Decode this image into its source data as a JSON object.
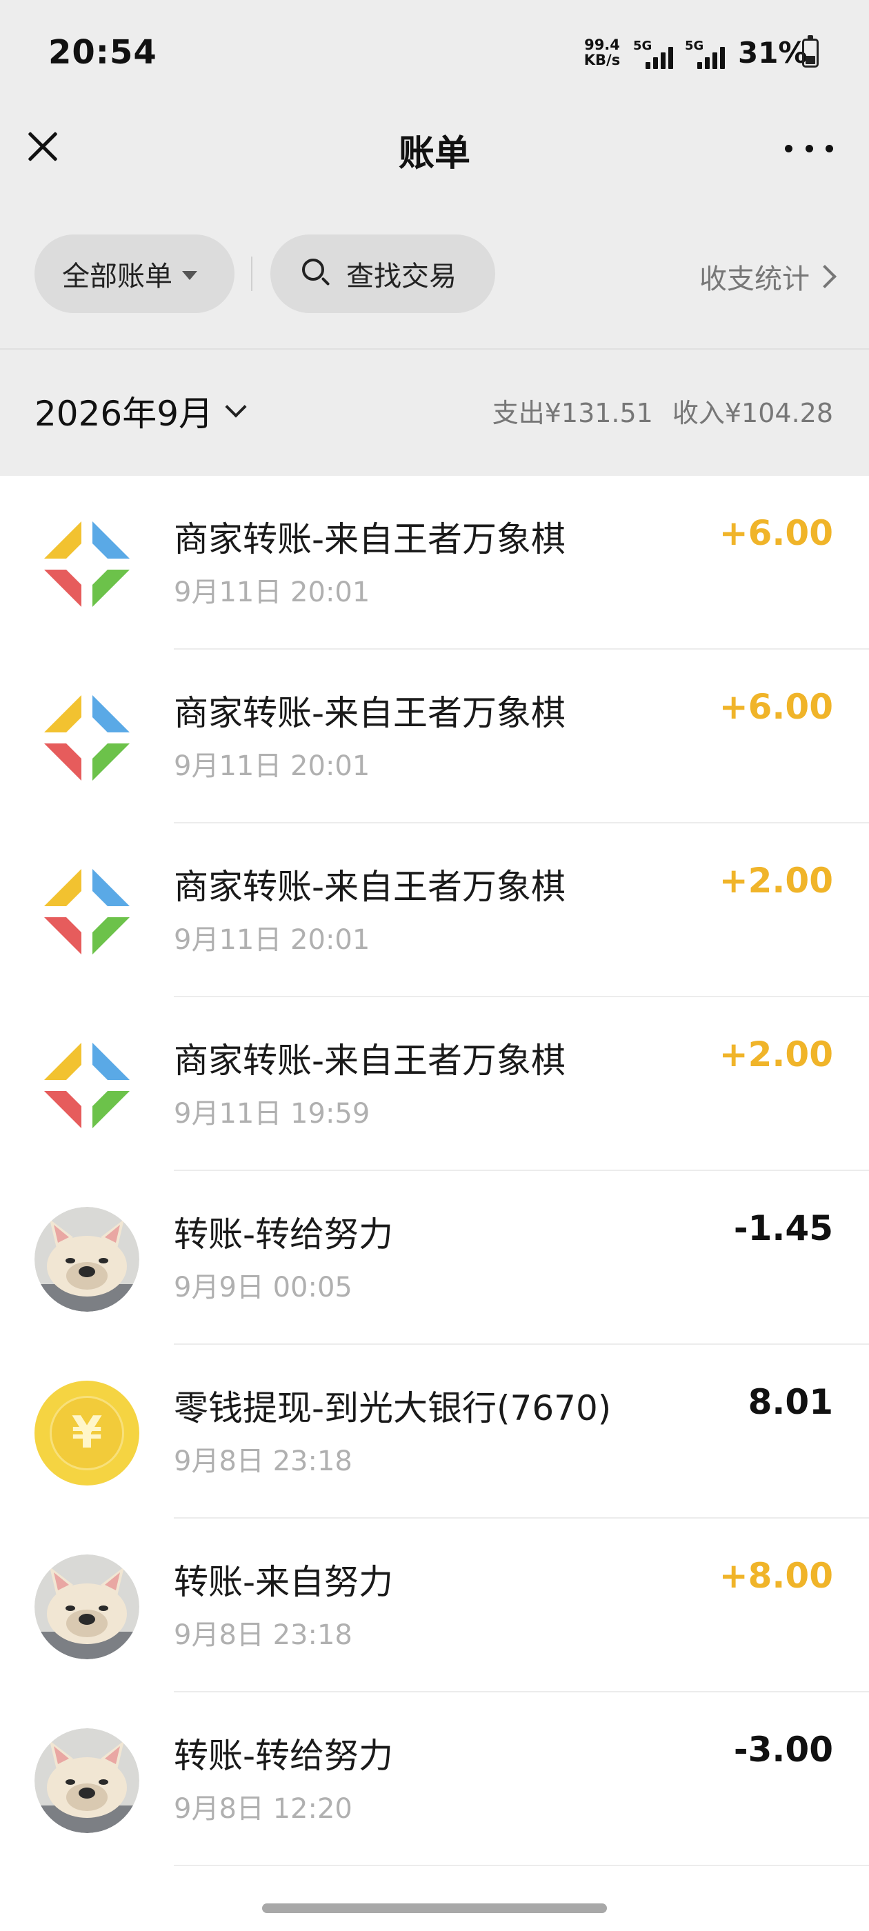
{
  "status_bar": {
    "time": "20:54",
    "net_speed_value": "99.4",
    "net_speed_unit": "KB/s",
    "signal_1_label": "5G",
    "signal_2_label": "5G",
    "battery": "31%"
  },
  "header": {
    "title": "账单"
  },
  "filters": {
    "all_bills": "全部账单",
    "search": "查找交易",
    "stats": "收支统计"
  },
  "month": {
    "label": "2026年9月",
    "expense": "支出¥131.51",
    "income": "收入¥104.28"
  },
  "transactions": [
    {
      "title": "商家转账-来自王者万象棋",
      "time": "9月11日 20:01",
      "amount": "+6.00",
      "kind": "in",
      "icon": "merchant-logo-icon"
    },
    {
      "title": "商家转账-来自王者万象棋",
      "time": "9月11日 20:01",
      "amount": "+6.00",
      "kind": "in",
      "icon": "merchant-logo-icon"
    },
    {
      "title": "商家转账-来自王者万象棋",
      "time": "9月11日 20:01",
      "amount": "+2.00",
      "kind": "in",
      "icon": "merchant-logo-icon"
    },
    {
      "title": "商家转账-来自王者万象棋",
      "time": "9月11日 19:59",
      "amount": "+2.00",
      "kind": "in",
      "icon": "merchant-logo-icon"
    },
    {
      "title": "转账-转给努力",
      "time": "9月9日 00:05",
      "amount": "-1.45",
      "kind": "out",
      "icon": "dog-avatar"
    },
    {
      "title": "零钱提现-到光大银行(7670)",
      "time": "9月8日 23:18",
      "amount": "8.01",
      "kind": "out",
      "icon": "yuan-coin-icon"
    },
    {
      "title": "转账-来自努力",
      "time": "9月8日 23:18",
      "amount": "+8.00",
      "kind": "in",
      "icon": "dog-avatar"
    },
    {
      "title": "转账-转给努力",
      "time": "9月8日 12:20",
      "amount": "-3.00",
      "kind": "out",
      "icon": "dog-avatar"
    }
  ],
  "yuan_glyph": "¥",
  "colors": {
    "income": "#f0b429",
    "expense": "#111111",
    "background_top": "#ededed"
  }
}
